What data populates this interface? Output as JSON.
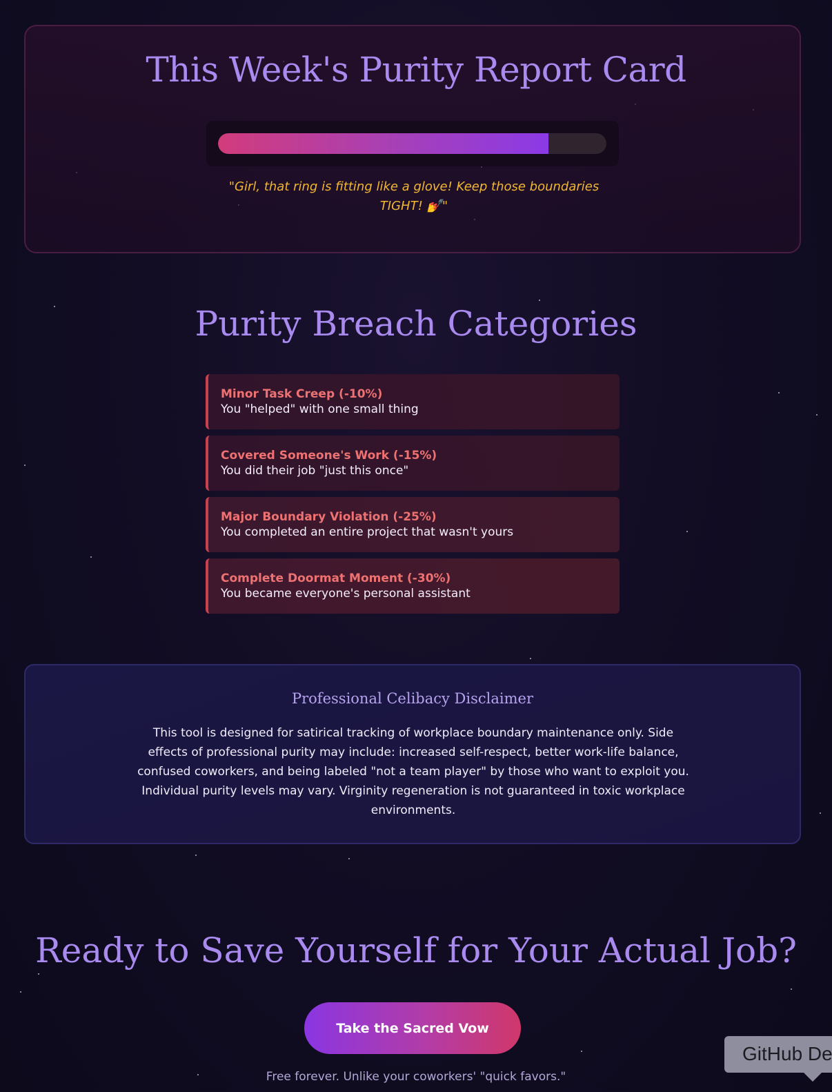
{
  "report_card": {
    "title": "This Week's Purity Report Card",
    "purity_level_percent": 85,
    "quote": "\"Girl, that ring is fitting like a glove! Keep those boundaries TIGHT! 💅\""
  },
  "breach_section": {
    "title": "Purity Breach Categories",
    "items": [
      {
        "name": "Minor Task Creep (-10%)",
        "description": "You \"helped\" with one small thing"
      },
      {
        "name": "Covered Someone's Work (-15%)",
        "description": "You did their job \"just this once\""
      },
      {
        "name": "Major Boundary Violation (-25%)",
        "description": "You completed an entire project that wasn't yours"
      },
      {
        "name": "Complete Doormat Moment (-30%)",
        "description": "You became everyone's personal assistant"
      }
    ]
  },
  "disclaimer": {
    "title": "Professional Celibacy Disclaimer",
    "text": "This tool is designed for satirical tracking of workplace boundary maintenance only. Side effects of professional purity may include: increased self-respect, better work-life balance, confused coworkers, and being labeled \"not a team player\" by those who want to exploit you. Individual purity levels may vary. Virginity regeneration is not guaranteed in toxic workplace environments."
  },
  "cta": {
    "title": "Ready to Save Yourself for Your Actual Job?",
    "button_label": "Take the Sacred Vow",
    "note": "Free forever. Unlike your coworkers' \"quick favors.\""
  },
  "tooltip": {
    "label": "GitHub De"
  },
  "colors": {
    "heading": "#a98bf0",
    "quote": "#f1b733",
    "breach_name": "#ee7272",
    "breach_border": "#c8414e",
    "meter_start": "#d23c7c",
    "meter_end": "#8b3ae6"
  }
}
